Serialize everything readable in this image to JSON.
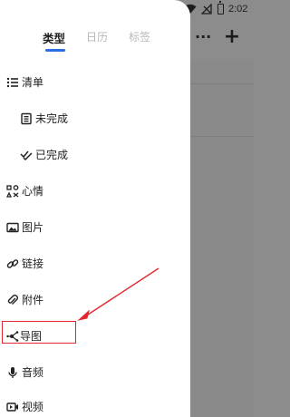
{
  "status_bar": {
    "time": "2:02",
    "icons": [
      "wifi-icon",
      "no-signal-icon",
      "battery-icon"
    ]
  },
  "background_app": {
    "toolbar_icons": [
      "more-icon",
      "add-icon"
    ],
    "more_glyph": "···",
    "add_glyph": "+"
  },
  "drawer": {
    "tabs": [
      {
        "label": "类型",
        "active": true
      },
      {
        "label": "日历",
        "active": false
      },
      {
        "label": "标签",
        "active": false
      }
    ],
    "accent_color": "#2b6de5",
    "items": [
      {
        "label": "清单",
        "icon": "list-icon",
        "indent": false
      },
      {
        "label": "未完成",
        "icon": "incomplete-icon",
        "indent": true
      },
      {
        "label": "已完成",
        "icon": "completed-icon",
        "indent": true
      },
      {
        "label": "心情",
        "icon": "mood-icon",
        "indent": false
      },
      {
        "label": "图片",
        "icon": "image-icon",
        "indent": false
      },
      {
        "label": "链接",
        "icon": "link-icon",
        "indent": false
      },
      {
        "label": "附件",
        "icon": "attachment-icon",
        "indent": false
      },
      {
        "label": "导图",
        "icon": "mindmap-icon",
        "indent": false,
        "highlighted": true
      },
      {
        "label": "音频",
        "icon": "microphone-icon",
        "indent": false
      },
      {
        "label": "视频",
        "icon": "video-icon",
        "indent": false
      }
    ]
  },
  "annotation_color": "#e0282e"
}
